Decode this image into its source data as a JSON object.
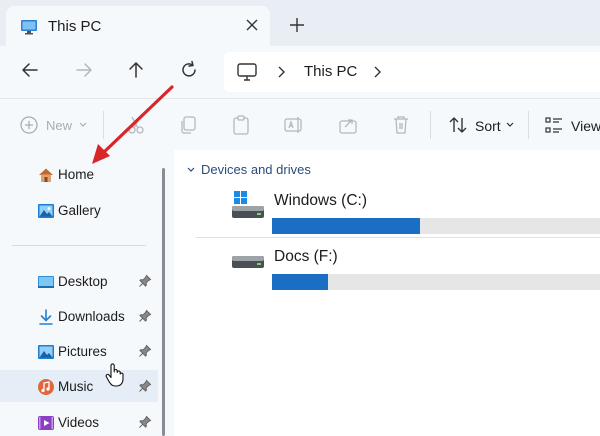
{
  "window": {
    "tab_title": "This PC",
    "tab_icon": "computer-icon",
    "close_icon": "close-icon",
    "new_tab_icon": "plus-icon"
  },
  "navigation": {
    "back_icon": "arrow-left-icon",
    "forward_icon": "arrow-right-icon",
    "up_icon": "arrow-up-icon",
    "refresh_icon": "refresh-icon",
    "breadcrumb": [
      "This PC"
    ]
  },
  "toolbar": {
    "new_label": "New",
    "sort_label": "Sort",
    "view_label": "View",
    "icons": [
      "plus-circle-icon",
      "cut-icon",
      "copy-icon",
      "paste-icon",
      "rename-icon",
      "share-icon",
      "delete-icon",
      "sort-icon",
      "view-icon"
    ]
  },
  "sidebar": {
    "items": [
      {
        "label": "Home",
        "icon": "home-icon",
        "pinned": false
      },
      {
        "label": "Gallery",
        "icon": "gallery-icon",
        "pinned": false
      },
      {
        "label": "Desktop",
        "icon": "desktop-folder-icon",
        "pinned": true
      },
      {
        "label": "Downloads",
        "icon": "download-icon",
        "pinned": true
      },
      {
        "label": "Pictures",
        "icon": "pictures-icon",
        "pinned": true
      },
      {
        "label": "Music",
        "icon": "music-icon",
        "pinned": true
      },
      {
        "label": "Videos",
        "icon": "videos-icon",
        "pinned": true
      }
    ],
    "hovered_item": "Music"
  },
  "main": {
    "group_label": "Devices and drives",
    "drives": [
      {
        "name": "Windows (C:)",
        "icon": "windows-drive-icon",
        "used_fraction": 0.45
      },
      {
        "name": "Docs (F:)",
        "icon": "drive-icon",
        "used_fraction": 0.17
      }
    ]
  },
  "colors": {
    "accent": "#1a6fc4",
    "bar_track": "#e6e6e6",
    "annotation_arrow": "#d9262b",
    "sidebar_bg": "#f6f9fc"
  },
  "annotation": {
    "type": "arrow",
    "points_to": "Home"
  }
}
